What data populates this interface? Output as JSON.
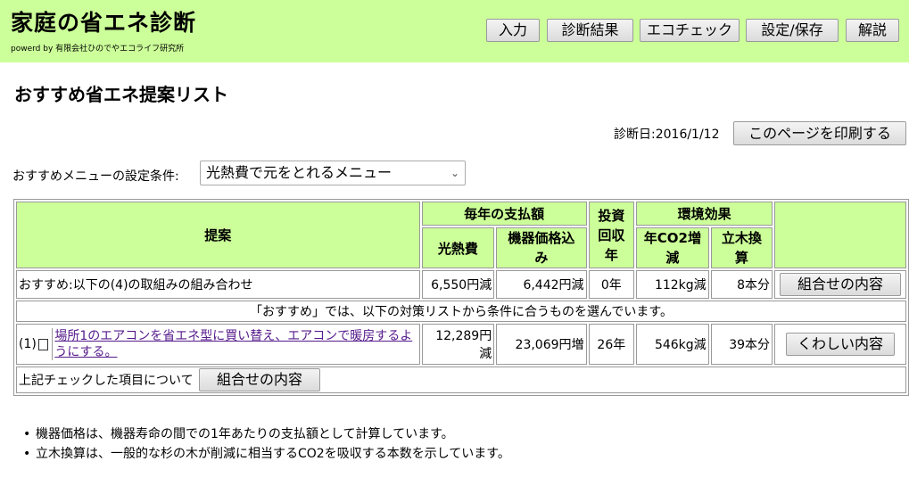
{
  "header": {
    "title": "家庭の省エネ診断",
    "powered_by": "powerd by 有限会社ひのでやエコライフ研究所",
    "nav": [
      "入力",
      "診断結果",
      "エコチェック",
      "設定/保存",
      "解説"
    ]
  },
  "page": {
    "title": "おすすめ省エネ提案リスト",
    "date_label": "診断日:2016/1/12",
    "print_button": "このページを印刷する",
    "condition_label": "おすすめメニューの設定条件:",
    "condition_value": "光熱費で元をとれるメニュー"
  },
  "table": {
    "headers": {
      "proposal": "提案",
      "annual": "毎年の支払額",
      "payback": "投資回収年",
      "env": "環境効果",
      "utility": "光熱費",
      "equipment": "機器価格込み",
      "co2": "年CO2増減",
      "trees": "立木換算"
    },
    "summary_row": {
      "label": "おすすめ:以下の(4)の取組みの組み合わせ",
      "utility": "6,550円減",
      "equipment": "6,442円減",
      "payback": "0年",
      "co2": "112kg減",
      "trees": "8本分",
      "button": "組合せの内容"
    },
    "info_row": "「おすすめ」では、以下の対策リストから条件に合うものを選んでいます。",
    "items": [
      {
        "num": "(1)",
        "text": "場所1のエアコンを省エネ型に買い替え、エアコンで暖房するようにする。",
        "utility": "12,289円減",
        "equipment": "23,069円増",
        "payback": "26年",
        "co2": "546kg減",
        "trees": "39本分",
        "button": "くわしい内容"
      }
    ],
    "footer_label": "上記チェックした項目について",
    "footer_button": "組合せの内容"
  },
  "notes": [
    "機器価格は、機器寿命の間での1年あたりの支払額として計算しています。",
    "立木換算は、一般的な杉の木が削減に相当するCO2を吸収する本数を示しています。"
  ]
}
